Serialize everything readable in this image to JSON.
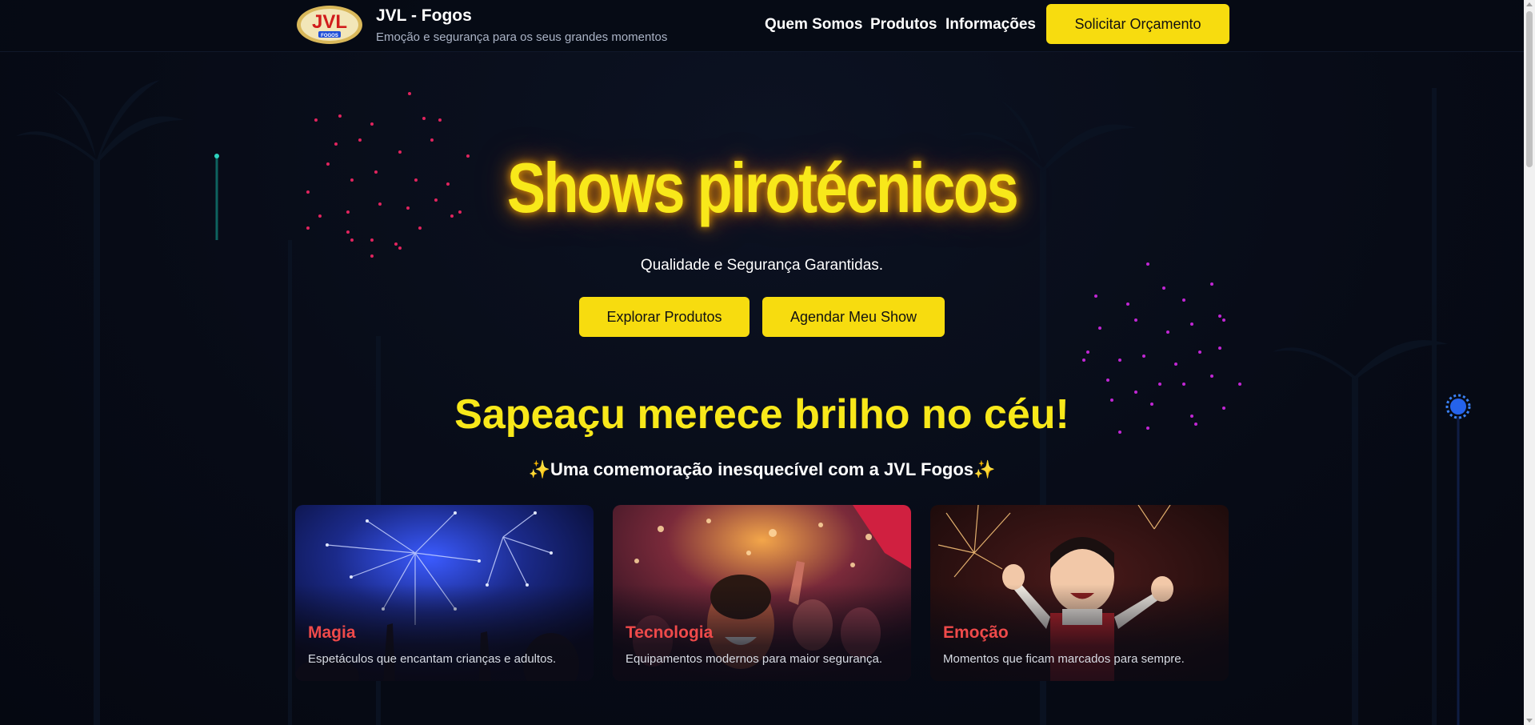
{
  "header": {
    "brand_title": "JVL - Fogos",
    "brand_subtitle": "Emoção e segurança para os seus grandes momentos",
    "logo_text": "JVL",
    "logo_subtext": "FOGOS",
    "nav": [
      "Quem Somos",
      "Produtos",
      "Informações"
    ],
    "cta_label": "Solicitar Orçamento"
  },
  "hero": {
    "title": "Shows pirotécnicos",
    "subtitle": "Qualidade e Segurança Garantidas.",
    "explore_label": "Explorar Produtos",
    "schedule_label": "Agendar Meu Show"
  },
  "section": {
    "title": "Sapeaçu merece brilho no céu!",
    "subtitle": "✨Uma comemoração inesquecível com a JVL Fogos✨"
  },
  "cards": [
    {
      "title": "Magia",
      "text": "Espetáculos que encantam crianças e adultos."
    },
    {
      "title": "Tecnologia",
      "text": "Equipamentos modernos para maior segurança."
    },
    {
      "title": "Emoção",
      "text": "Momentos que ficam marcados para sempre."
    }
  ],
  "colors": {
    "background": "#070b16",
    "accent_yellow": "#f7dc0f",
    "title_yellow": "#f8e81a",
    "card_title_red": "#ef4a4a"
  }
}
